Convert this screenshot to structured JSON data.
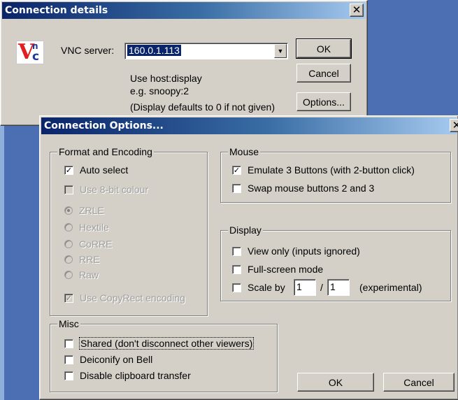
{
  "connection_details": {
    "title": "Connection details",
    "close_glyph": "✕",
    "logo_letters": [
      "V",
      "n",
      "c"
    ],
    "server_label": "VNC server:",
    "server_value": "160.0.1.113",
    "dropdown_glyph": "▼",
    "hint_lines": [
      "Use host:display",
      "e.g. snoopy:2",
      "(Display defaults to 0 if not given)"
    ],
    "ok_label": "OK",
    "cancel_label": "Cancel",
    "options_label": "Options..."
  },
  "connection_options": {
    "title": "Connection Options...",
    "close_glyph": "✕",
    "format_group": {
      "title": "Format and Encoding",
      "auto_select": {
        "label": "Auto select",
        "checked": true
      },
      "use_8bit": {
        "label": "Use 8-bit colour",
        "checked": false,
        "enabled": false
      },
      "encodings": [
        {
          "label": "ZRLE",
          "selected": true
        },
        {
          "label": "Hextile",
          "selected": false
        },
        {
          "label": "CoRRE",
          "selected": false
        },
        {
          "label": "RRE",
          "selected": false
        },
        {
          "label": "Raw",
          "selected": false
        }
      ],
      "copyrect": {
        "label": "Use CopyRect encoding",
        "checked": true,
        "enabled": false
      }
    },
    "mouse_group": {
      "title": "Mouse",
      "emulate3": {
        "label": "Emulate 3 Buttons (with 2-button click)",
        "checked": true
      },
      "swap": {
        "label": "Swap mouse buttons 2 and 3",
        "checked": false
      }
    },
    "display_group": {
      "title": "Display",
      "view_only": {
        "label": "View only (inputs ignored)",
        "checked": false
      },
      "full_screen": {
        "label": "Full-screen mode",
        "checked": false
      },
      "scale": {
        "label": "Scale by",
        "numerator": "1",
        "separator": "/",
        "denominator": "1",
        "note": "(experimental)",
        "checked": false
      }
    },
    "misc_group": {
      "title": "Misc",
      "shared": {
        "label": "Shared (don't disconnect other viewers)",
        "checked": false
      },
      "deiconify": {
        "label": "Deiconify on Bell",
        "checked": false
      },
      "disable_clipboard": {
        "label": "Disable clipboard transfer",
        "checked": false
      }
    },
    "ok_label": "OK",
    "cancel_label": "Cancel"
  },
  "colors": {
    "title_start": "#0a246a",
    "title_end": "#a6caf0",
    "window_face": "#d4d0c8",
    "desktop": "#4b6fb2"
  }
}
